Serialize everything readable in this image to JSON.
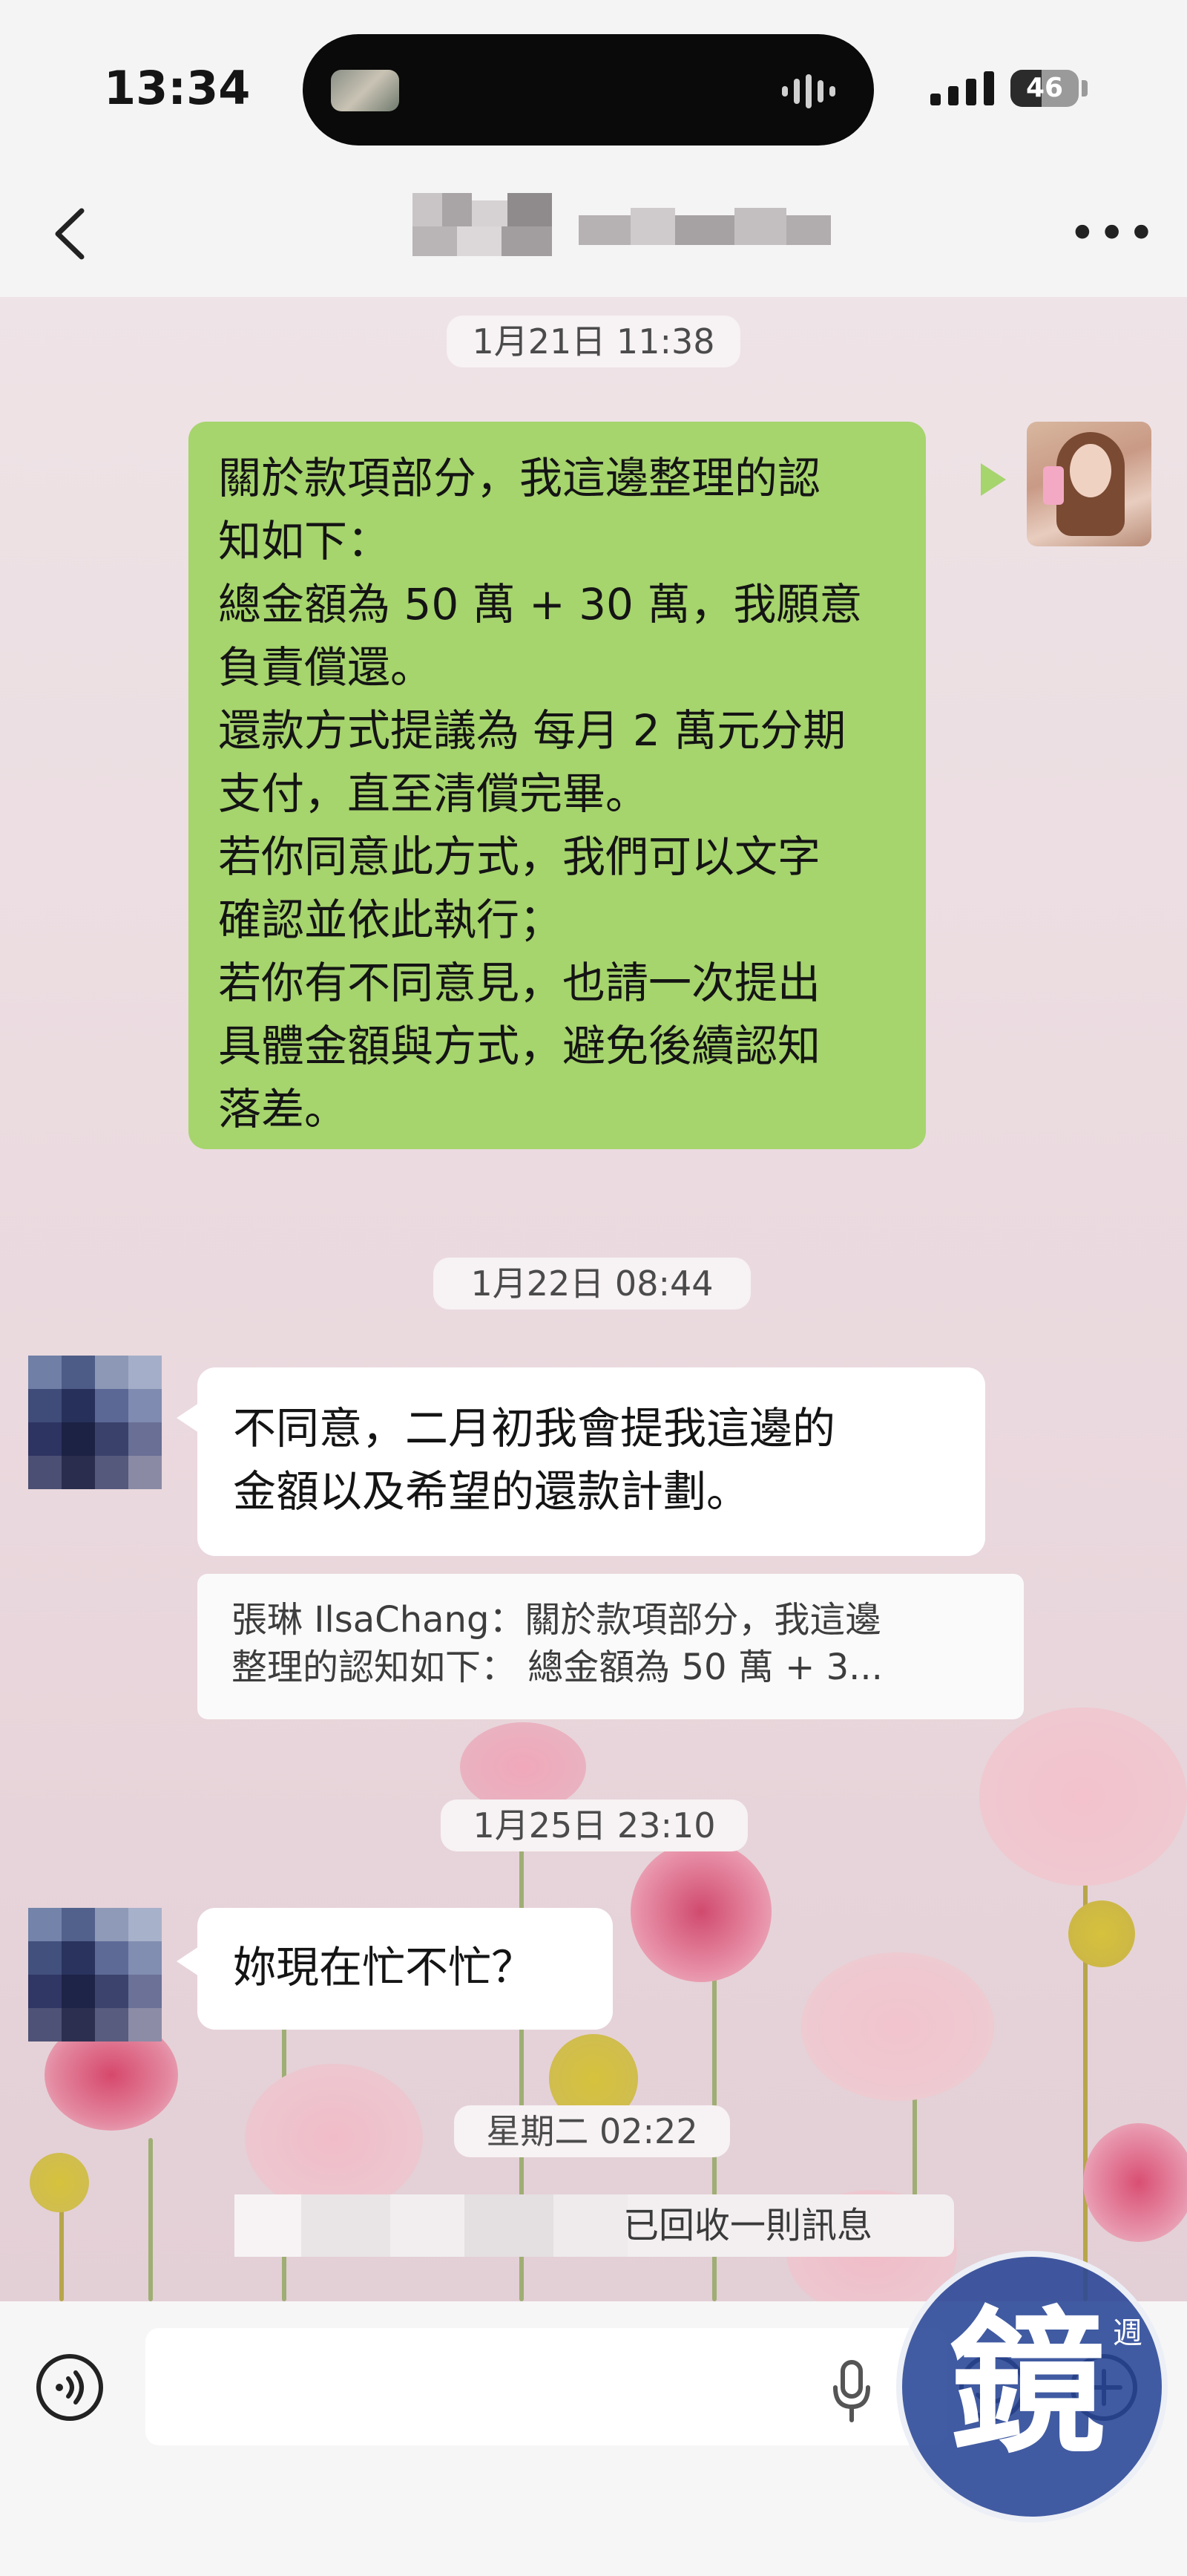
{
  "status_bar": {
    "time": "13:34",
    "battery": "46",
    "battery_level": 0.46
  },
  "header": {
    "more": "•••"
  },
  "messages": [
    {
      "type": "date",
      "text": "1月21日 11:38"
    },
    {
      "type": "sent",
      "text": "關於款項部分，我這邊整理的認\n知如下：\n總金額為 50 萬 + 30 萬，我願意\n負責償還。\n還款方式提議為 每月 2 萬元分期\n支付，直至清償完畢。\n若你同意此方式，我們可以文字\n確認並依此執行；\n若你有不同意見，也請一次提出\n具體金額與方式，避免後續認知\n落差。"
    },
    {
      "type": "date",
      "text": "1月22日 08:44"
    },
    {
      "type": "received",
      "text": "不同意，二月初我會提我這邊的\n金額以及希望的還款計劃。"
    },
    {
      "type": "quote",
      "text": "張琳 IlsaChang：關於款項部分，我這邊\n整理的認知如下：  總金額為 50 萬 + 3..."
    },
    {
      "type": "date",
      "text": "1月25日 23:10"
    },
    {
      "type": "received",
      "text": "妳現在忙不忙？"
    },
    {
      "type": "date",
      "text": "星期二 02:22"
    },
    {
      "type": "recalled",
      "text": "已回收一則訊息"
    }
  ],
  "watermark": {
    "char": "鏡",
    "small": "週"
  },
  "colors": {
    "sent_bubble": "#a6d46d",
    "received_bubble": "#ffffff",
    "watermark": "#284696"
  }
}
